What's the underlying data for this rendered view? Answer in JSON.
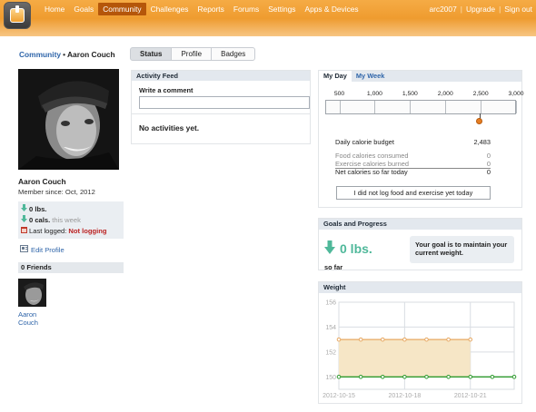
{
  "nav": {
    "items": [
      "Home",
      "Goals",
      "Community",
      "Challenges",
      "Reports",
      "Forums",
      "Settings",
      "Apps & Devices"
    ],
    "active_index": 2,
    "username": "arc2007",
    "upgrade": "Upgrade",
    "sign_out": "Sign out",
    "separator": "|"
  },
  "breadcrumb": {
    "root": "Community",
    "current": "Aaron Couch"
  },
  "profile": {
    "name": "Aaron Couch",
    "member_since": "Member since: Oct, 2012",
    "weight_change": "0 lbs.",
    "calories_value": "0 cals.",
    "calories_period": "this week",
    "last_logged_label": "Last logged:",
    "last_logged_value": "Not logging",
    "edit_profile": "Edit Profile"
  },
  "friends": {
    "header": "0 Friends",
    "items": [
      {
        "name": "Aaron Couch"
      }
    ]
  },
  "tabs": {
    "items": [
      "Status",
      "Profile",
      "Badges"
    ],
    "active_index": 0
  },
  "activity_feed": {
    "title": "Activity Feed",
    "write_label": "Write a comment",
    "comment_value": "",
    "empty_message": "No activities yet."
  },
  "calories": {
    "tabs": [
      "My Day",
      "My Week"
    ],
    "active_tab": 0,
    "scale_labels": [
      "500",
      "1,000",
      "1,500",
      "2,000",
      "2,500",
      "3,000"
    ],
    "scale_values": [
      500,
      1000,
      1500,
      2000,
      2500,
      3000
    ],
    "marker_value": 2483,
    "budget_label": "Daily calorie budget",
    "budget_value": "2,483",
    "consumed_label": "Food calories consumed",
    "consumed_value": "0",
    "burned_label": "Exercise calories burned",
    "burned_value": "0",
    "net_label": "Net calories so far today",
    "net_value": "0",
    "no_log_button": "I did not log food and exercise yet today"
  },
  "goals": {
    "title": "Goals and Progress",
    "weight_value": "0 lbs.",
    "so_far": "so far",
    "message": "Your goal is to maintain your current weight."
  },
  "weight_chart": {
    "title": "Weight",
    "colors": {
      "goal": "#e7a862",
      "goal_fill": "#f6e6c6",
      "actual": "#2e9a2e",
      "grid": "#d9dde2",
      "axis_text": "#aaaaaa"
    }
  },
  "chart_data": {
    "type": "line",
    "title": "Weight",
    "xlabel": "",
    "ylabel": "",
    "ylim": [
      149,
      156
    ],
    "yticks": [
      150,
      152,
      154,
      156
    ],
    "x_tick_labels": [
      "2012-10-15",
      "2012-10-18",
      "2012-10-21"
    ],
    "x": [
      "2012-10-15",
      "2012-10-16",
      "2012-10-17",
      "2012-10-18",
      "2012-10-19",
      "2012-10-20",
      "2012-10-21",
      "2012-10-22",
      "2012-10-23"
    ],
    "series": [
      {
        "values": [
          153,
          153,
          153,
          153,
          153,
          153,
          153,
          null,
          null
        ]
      },
      {
        "values": [
          150,
          150,
          150,
          150,
          150,
          150,
          150,
          150,
          150
        ]
      }
    ],
    "grid": true
  }
}
